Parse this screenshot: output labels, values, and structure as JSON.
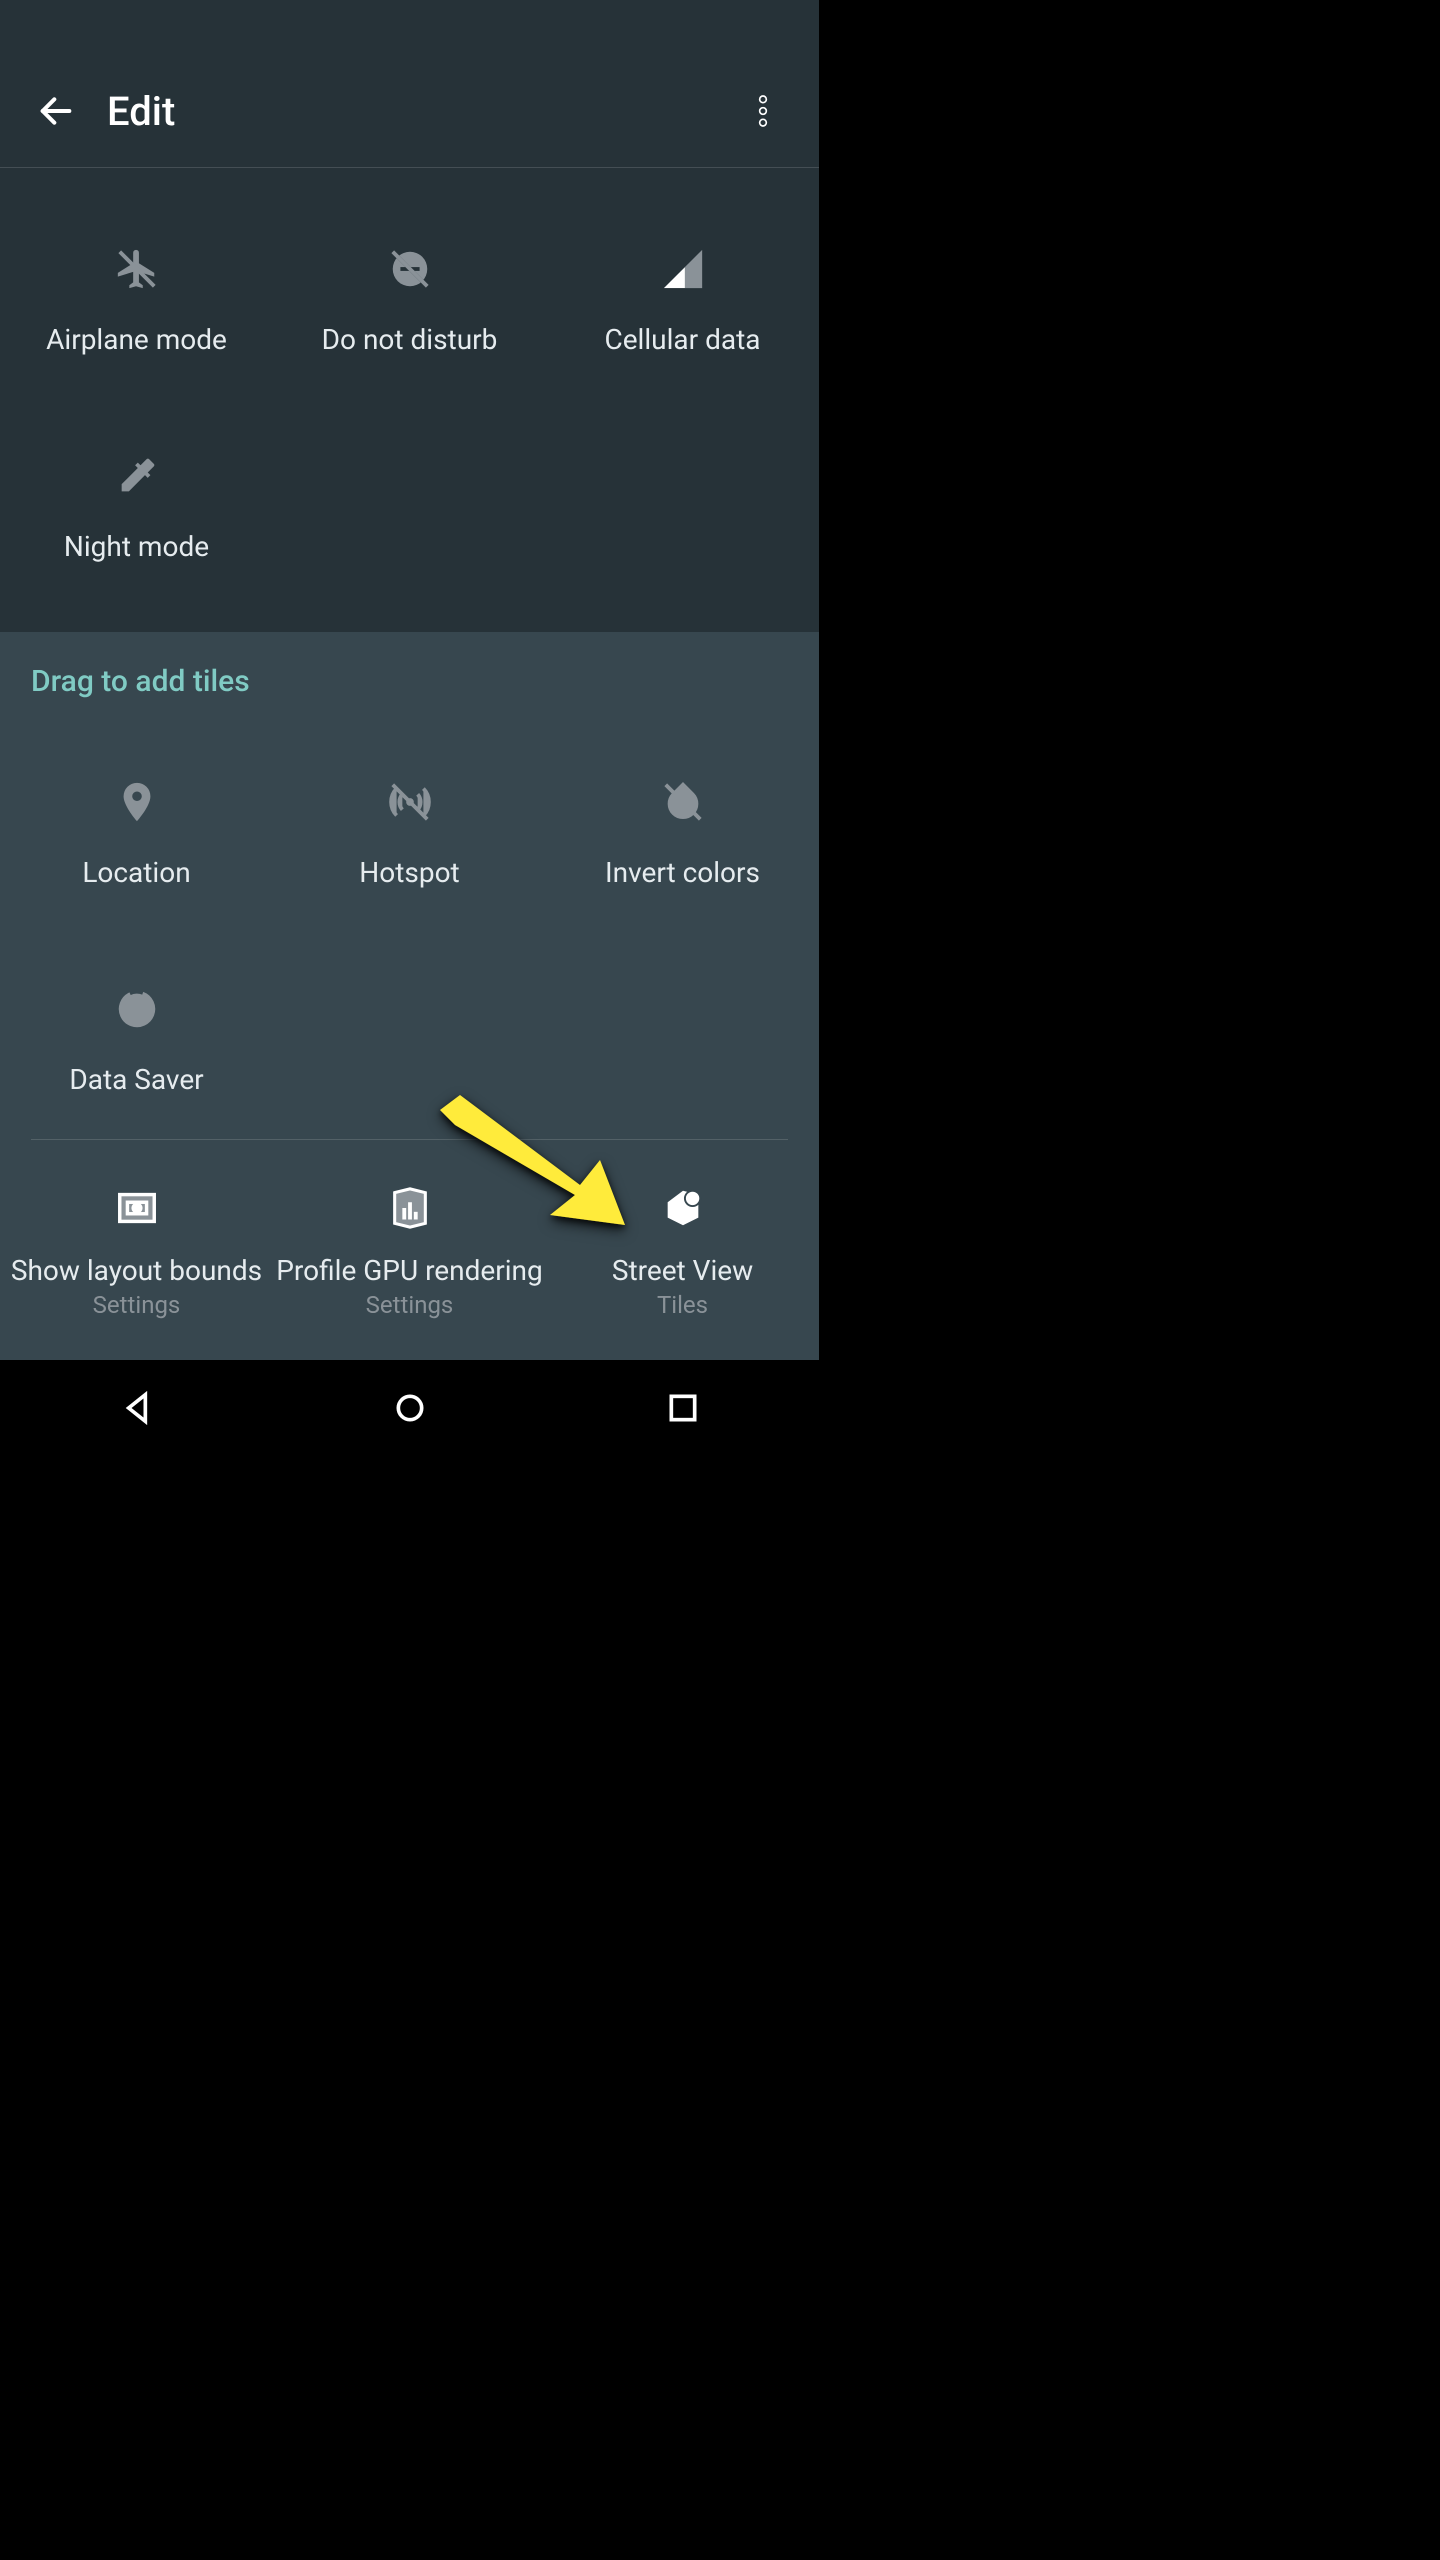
{
  "header": {
    "title": "Edit"
  },
  "active_tiles": [
    {
      "id": "airplane",
      "label": "Airplane mode"
    },
    {
      "id": "dnd",
      "label": "Do not disturb"
    },
    {
      "id": "cell",
      "label": "Cellular data"
    },
    {
      "id": "night",
      "label": "Night mode"
    }
  ],
  "section_title": "Drag to add tiles",
  "available_tiles_a": [
    {
      "id": "location",
      "label": "Location"
    },
    {
      "id": "hotspot",
      "label": "Hotspot"
    },
    {
      "id": "invert",
      "label": "Invert colors"
    },
    {
      "id": "datasaver",
      "label": "Data Saver"
    }
  ],
  "available_tiles_b": [
    {
      "id": "layout",
      "label": "Show layout bounds",
      "sub": "Settings"
    },
    {
      "id": "gpu",
      "label": "Profile GPU rendering",
      "sub": "Settings"
    },
    {
      "id": "streetview",
      "label": "Street View",
      "sub": "Tiles"
    }
  ]
}
